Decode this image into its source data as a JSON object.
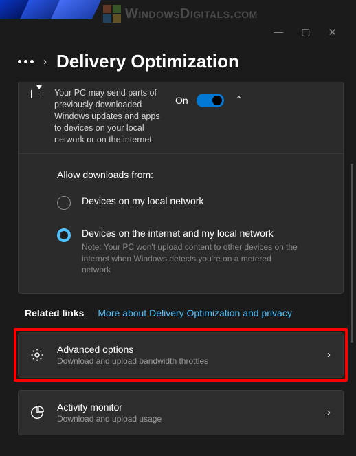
{
  "watermark": {
    "text": "WindowsDigitals.com"
  },
  "titlebar": {
    "minimize": "—",
    "maximize": "▢",
    "close": "✕"
  },
  "header": {
    "title": "Delivery Optimization"
  },
  "delivery_card": {
    "description": "Your PC may send parts of previously downloaded Windows updates and apps to devices on your local network or on the internet",
    "toggle_state_label": "On",
    "toggle_on": true
  },
  "allow_downloads": {
    "label": "Allow downloads from:",
    "options": [
      {
        "label": "Devices on my local network",
        "checked": false
      },
      {
        "label": "Devices on the internet and my local network",
        "note": "Note: Your PC won't upload content to other devices on the internet when Windows detects you're on a metered network",
        "checked": true
      }
    ]
  },
  "related": {
    "label": "Related links",
    "link_text": "More about Delivery Optimization and privacy"
  },
  "items": {
    "advanced": {
      "title": "Advanced options",
      "subtitle": "Download and upload bandwidth throttles"
    },
    "activity": {
      "title": "Activity monitor",
      "subtitle": "Download and upload usage"
    }
  }
}
